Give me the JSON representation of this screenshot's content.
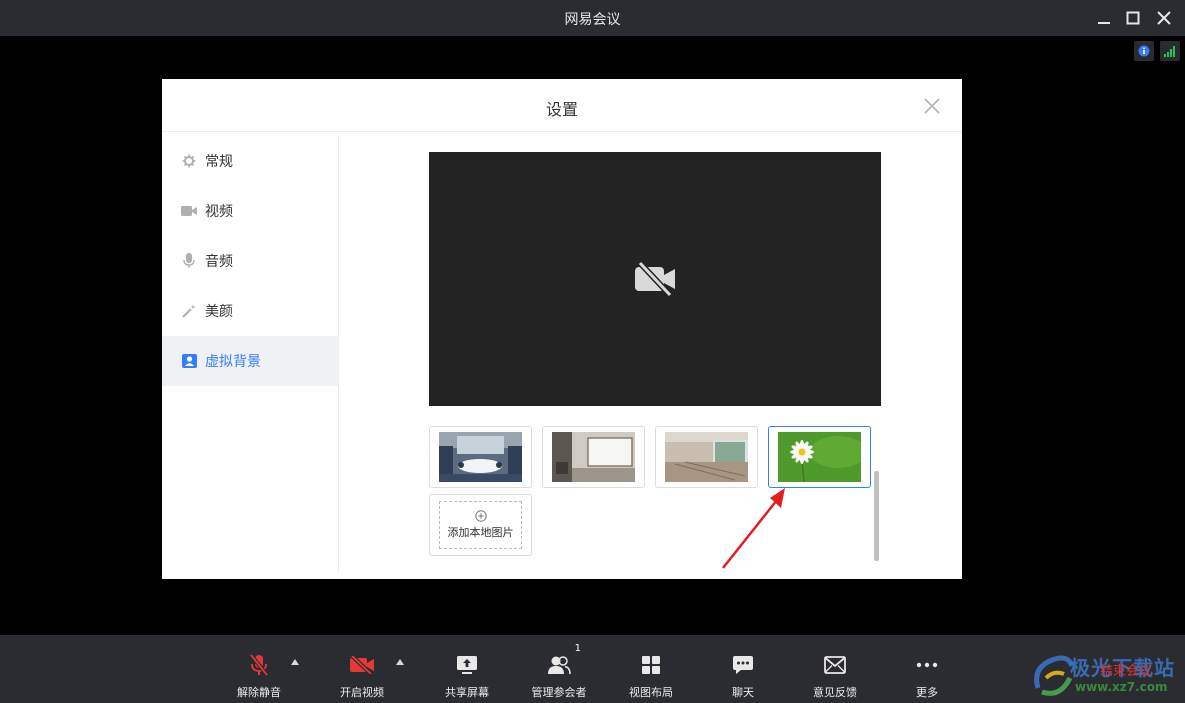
{
  "window": {
    "title": "网易会议"
  },
  "dialog": {
    "title": "设置",
    "nav": [
      {
        "label": "常规",
        "icon": "gear-icon"
      },
      {
        "label": "视频",
        "icon": "camera-icon"
      },
      {
        "label": "音频",
        "icon": "microphone-icon"
      },
      {
        "label": "美颜",
        "icon": "magic-wand-icon"
      },
      {
        "label": "虚拟背景",
        "icon": "portrait-icon",
        "active": true
      }
    ],
    "backgrounds": [
      {
        "name": "meeting-room"
      },
      {
        "name": "office-whiteboard"
      },
      {
        "name": "classroom"
      },
      {
        "name": "daisy",
        "selected": true
      }
    ],
    "add_local_label": "添加本地图片"
  },
  "toolbar": {
    "items": [
      {
        "label": "解除静音",
        "icon": "microphone-muted-icon"
      },
      {
        "label": "开启视频",
        "icon": "camera-off-icon"
      },
      {
        "label": "共享屏幕",
        "icon": "share-screen-icon"
      },
      {
        "label": "管理参会者",
        "icon": "participants-icon",
        "badge": "1"
      },
      {
        "label": "视图布局",
        "icon": "grid-layout-icon"
      },
      {
        "label": "聊天",
        "icon": "chat-icon"
      },
      {
        "label": "意见反馈",
        "icon": "mail-icon"
      },
      {
        "label": "更多",
        "icon": "more-icon"
      }
    ],
    "end_label": "结束会议"
  },
  "watermark": {
    "brand": "极光下载站",
    "url": "www.xz7.com"
  },
  "colors": {
    "accent": "#337eff",
    "danger": "#e53935",
    "bar": "#2b2c31"
  }
}
